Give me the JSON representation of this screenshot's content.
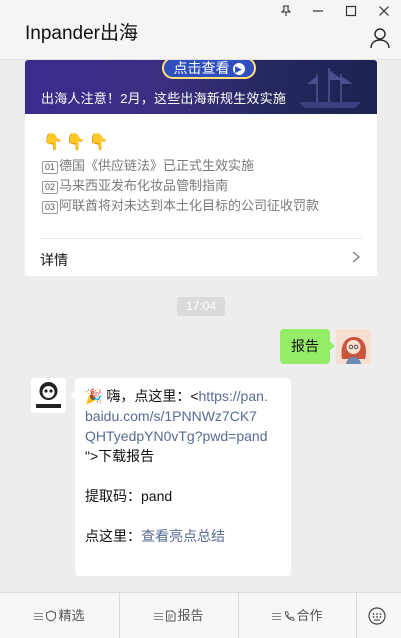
{
  "window": {
    "title": "Inpander出海",
    "pin_glyph": "⊥",
    "min_glyph": "—",
    "max_glyph": "☐",
    "close_glyph": "✕"
  },
  "article": {
    "banner_button": "点击查看",
    "banner_title": "出海人注意！2月，这些出海新规生效实施",
    "hands": "👇👇👇",
    "lines": [
      {
        "num": "01",
        "text": "德国《供应链法》已正式生效实施"
      },
      {
        "num": "02",
        "text": "马来西亚发布化妆品管制指南"
      },
      {
        "num": "03",
        "text": "阿联酋将对未达到本土化目标的公司征收罚款"
      }
    ],
    "details_label": "详情"
  },
  "timestamp": "17:04",
  "my_message": "报告",
  "bot_message": {
    "emoji": "🎉",
    "greeting": " 嗨，点这里：<",
    "url_line1": "https://pan.",
    "url_line2": "baidu.com/s/1PNNWz7CK7",
    "url_line3": "QHTyedpYN0vTg?pwd=pand",
    "suffix": "\">下载报告",
    "code_label": "提取码：pand",
    "click_label": "点这里：",
    "click_link": "查看亮点总结"
  },
  "menu": [
    {
      "label": "精选"
    },
    {
      "label": "报告"
    },
    {
      "label": "合作"
    }
  ]
}
